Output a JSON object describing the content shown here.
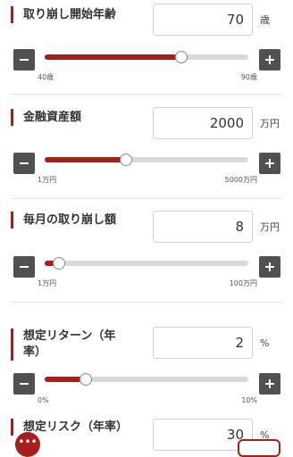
{
  "sections": [
    {
      "label": "取り崩し開始年齢",
      "value": "70",
      "unit": "歳",
      "min_label": "40歳",
      "max_label": "90歳",
      "slider_fraction": 0.67
    },
    {
      "label": "金融資産額",
      "value": "2000",
      "unit": "万円",
      "min_label": "1万円",
      "max_label": "5000万円",
      "slider_fraction": 0.4
    },
    {
      "label": "毎月の取り崩し額",
      "value": "8",
      "unit": "万円",
      "min_label": "1万円",
      "max_label": "100万円",
      "slider_fraction": 0.07
    },
    {
      "label_line1": "想定リターン（年",
      "label_line2": "率）",
      "value": "2",
      "unit": "%",
      "min_label": "0%",
      "max_label": "10%",
      "slider_fraction": 0.2
    },
    {
      "label": "想定リスク（年率）",
      "value": "30",
      "unit": "%"
    }
  ],
  "colors": {
    "accent": "#a3201b",
    "button": "#505050",
    "track": "#d9d9d9"
  },
  "icons": {
    "minus": "minus-icon",
    "plus": "plus-icon",
    "chat": "chat-dots-icon"
  },
  "floating": {
    "chat_text": "•••"
  }
}
